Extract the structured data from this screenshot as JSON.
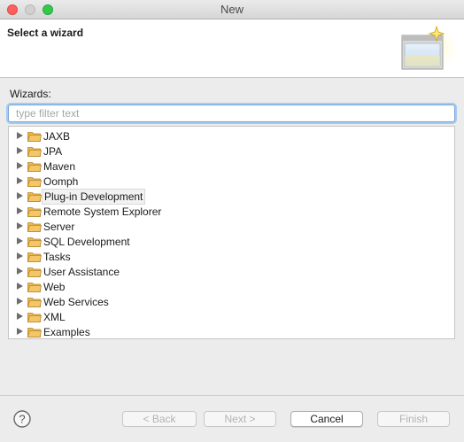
{
  "window": {
    "title": "New"
  },
  "banner": {
    "title": "Select a wizard"
  },
  "wizards": {
    "label": "Wizards:",
    "filter_placeholder": "type filter text",
    "filter_value": ""
  },
  "tree": {
    "items": [
      {
        "label": "JAXB",
        "selected": false
      },
      {
        "label": "JPA",
        "selected": false
      },
      {
        "label": "Maven",
        "selected": false
      },
      {
        "label": "Oomph",
        "selected": false
      },
      {
        "label": "Plug-in Development",
        "selected": true
      },
      {
        "label": "Remote System Explorer",
        "selected": false
      },
      {
        "label": "Server",
        "selected": false
      },
      {
        "label": "SQL Development",
        "selected": false
      },
      {
        "label": "Tasks",
        "selected": false
      },
      {
        "label": "User Assistance",
        "selected": false
      },
      {
        "label": "Web",
        "selected": false
      },
      {
        "label": "Web Services",
        "selected": false
      },
      {
        "label": "XML",
        "selected": false
      },
      {
        "label": "Examples",
        "selected": false
      }
    ]
  },
  "buttons": {
    "back": "< Back",
    "next": "Next >",
    "cancel": "Cancel",
    "finish": "Finish"
  },
  "icons": {
    "traffic_close": "close-icon",
    "traffic_minimize": "minimize-icon",
    "traffic_maximize": "maximize-icon",
    "banner": "wizard-banner-icon",
    "help": "help-icon",
    "folder": "folder-icon",
    "expand": "expand-arrow-icon"
  },
  "colors": {
    "close": "#fc605c",
    "maximize": "#34c84a",
    "folder": "#f3c768",
    "focus_ring": "#a9c9ee"
  }
}
